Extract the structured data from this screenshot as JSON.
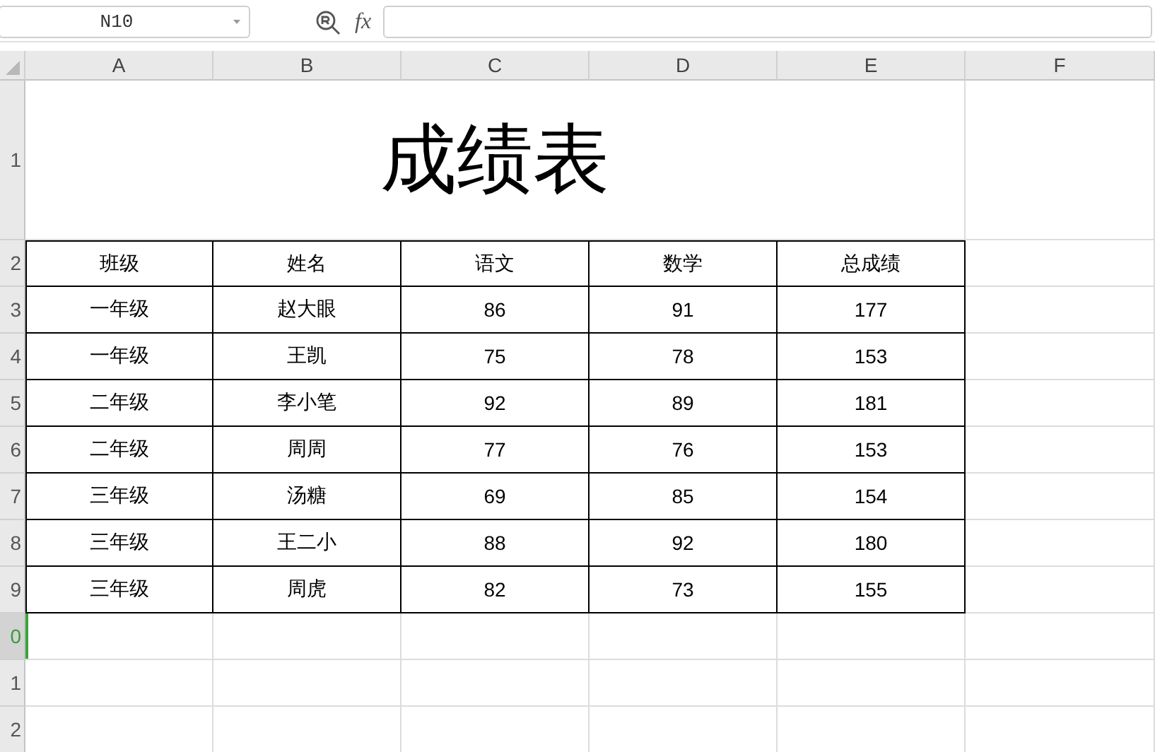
{
  "toolbar": {
    "cell_reference": "N10",
    "function_label": "fx"
  },
  "columns": [
    "A",
    "B",
    "C",
    "D",
    "E",
    "F"
  ],
  "rows": [
    {
      "label": "1",
      "selected": false
    },
    {
      "label": "2",
      "selected": false
    },
    {
      "label": "3",
      "selected": false
    },
    {
      "label": "4",
      "selected": false
    },
    {
      "label": "5",
      "selected": false
    },
    {
      "label": "6",
      "selected": false
    },
    {
      "label": "7",
      "selected": false
    },
    {
      "label": "8",
      "selected": false
    },
    {
      "label": "9",
      "selected": false
    },
    {
      "label": "0",
      "selected": true
    },
    {
      "label": "1",
      "selected": false
    },
    {
      "label": "2",
      "selected": false
    }
  ],
  "title": "成绩表",
  "table": {
    "header": [
      "班级",
      "姓名",
      "语文",
      "数学",
      "总成绩"
    ],
    "rows": [
      [
        "一年级",
        "赵大眼",
        "86",
        "91",
        "177"
      ],
      [
        "一年级",
        "王凯",
        "75",
        "78",
        "153"
      ],
      [
        "二年级",
        "李小笔",
        "92",
        "89",
        "181"
      ],
      [
        "二年级",
        "周周",
        "77",
        "76",
        "153"
      ],
      [
        "三年级",
        "汤糖",
        "69",
        "85",
        "154"
      ],
      [
        "三年级",
        "王二小",
        "88",
        "92",
        "180"
      ],
      [
        "三年级",
        "周虎",
        "82",
        "73",
        "155"
      ]
    ]
  }
}
